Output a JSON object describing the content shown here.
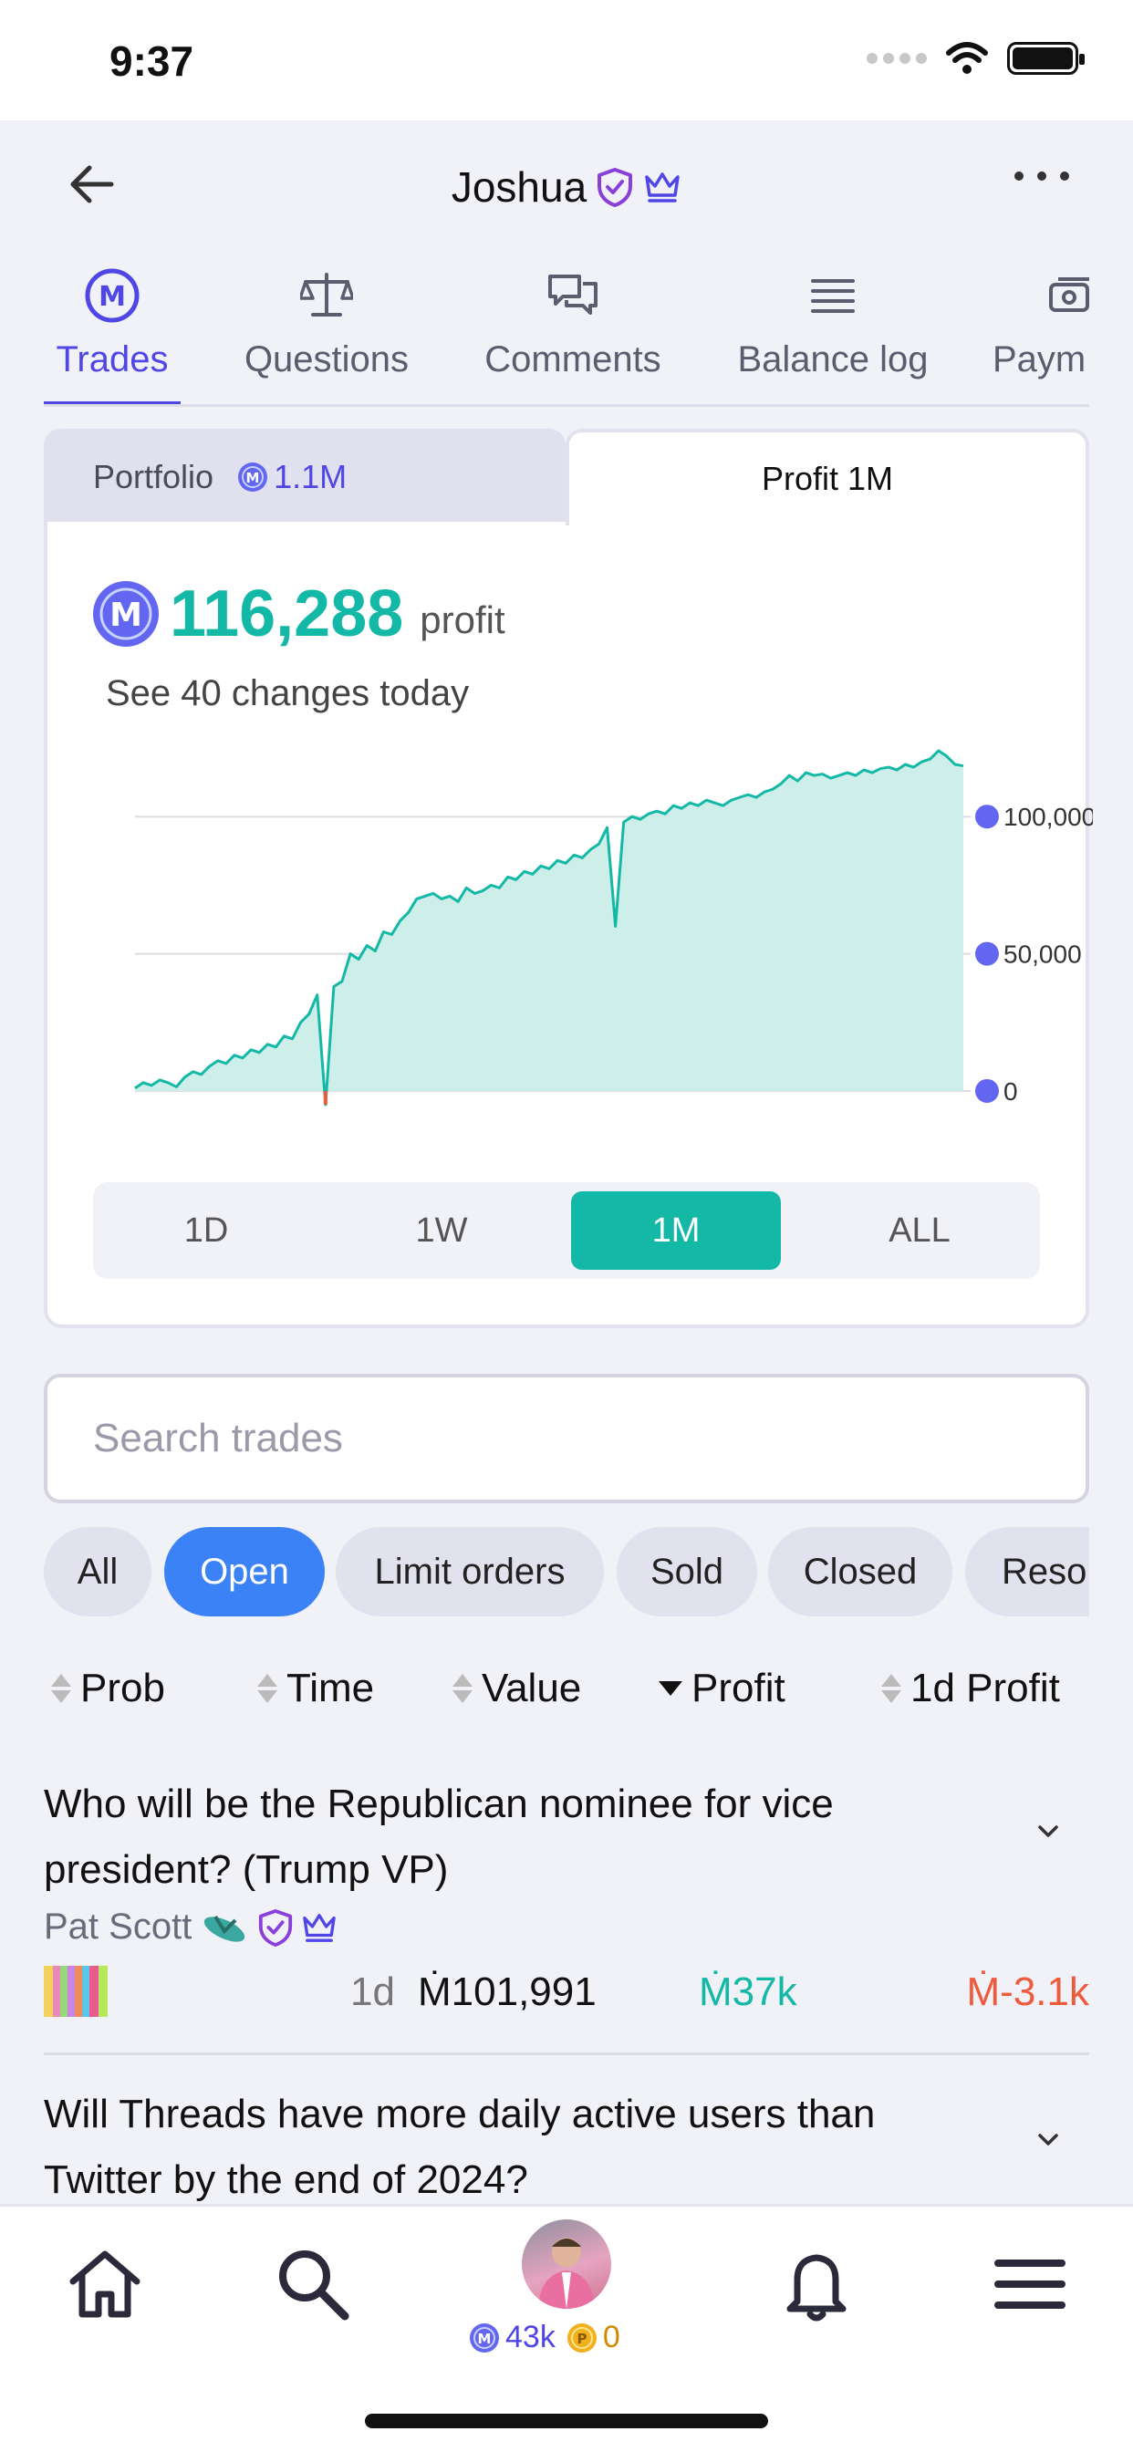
{
  "status_bar": {
    "time": "9:37"
  },
  "header": {
    "title": "Joshua"
  },
  "tabs": [
    {
      "label": "Trades",
      "icon": "mana-icon"
    },
    {
      "label": "Questions",
      "icon": "scale-icon"
    },
    {
      "label": "Comments",
      "icon": "chat-icon"
    },
    {
      "label": "Balance log",
      "icon": "list-icon"
    },
    {
      "label": "Paym",
      "icon": "payments-icon"
    }
  ],
  "portfolio": {
    "left_tab_label": "Portfolio",
    "left_tab_value": "1.1M",
    "right_tab_label": "Profit 1M",
    "profit_value": "116,288",
    "profit_word": "profit",
    "changes_text": "See 40 changes today",
    "ranges": [
      "1D",
      "1W",
      "1M",
      "ALL"
    ],
    "selected_range": "1M"
  },
  "chart_data": {
    "type": "area",
    "ylim": [
      -8000,
      125000
    ],
    "y_ticks": [
      0,
      50000,
      100000
    ],
    "y_tick_labels": [
      "0",
      "50,000",
      "100,000"
    ],
    "grid": true,
    "series": [
      {
        "color": "#14b8a6",
        "fill": "#cdeee9",
        "x": [
          0,
          1,
          2,
          3,
          4,
          5,
          6,
          7,
          8,
          9,
          10,
          11,
          12,
          13,
          14,
          15,
          16,
          17,
          18,
          19,
          20,
          21,
          22,
          23,
          24,
          25,
          26,
          27,
          28,
          29,
          30,
          31,
          32,
          33,
          34,
          35,
          36,
          37,
          38,
          39,
          40,
          41,
          42,
          43,
          44,
          45,
          46,
          47,
          48,
          49,
          50,
          51,
          52,
          53,
          54,
          55,
          56,
          57,
          58,
          59,
          60,
          61,
          62,
          63,
          64,
          65,
          66,
          67,
          68,
          69,
          70,
          71,
          72,
          73,
          74,
          75,
          76,
          77,
          78,
          79,
          80,
          81,
          82,
          83,
          84,
          85,
          86,
          87,
          88,
          89,
          90,
          91,
          92,
          93,
          94,
          95,
          96,
          97,
          98,
          99,
          100
        ],
        "y": [
          1000,
          3000,
          2000,
          4000,
          3000,
          1500,
          5000,
          7000,
          6000,
          9000,
          11000,
          10000,
          13000,
          12000,
          15000,
          14000,
          17000,
          16000,
          20000,
          19000,
          25000,
          28000,
          35000,
          -5000,
          38000,
          40000,
          50000,
          48000,
          53000,
          51000,
          58000,
          57000,
          62000,
          65000,
          70000,
          71000,
          72000,
          70000,
          71000,
          69000,
          74000,
          72000,
          73000,
          75000,
          74000,
          78000,
          77000,
          80000,
          79000,
          82000,
          81000,
          84000,
          83000,
          86000,
          85000,
          88000,
          90000,
          96000,
          60000,
          98000,
          100000,
          99000,
          101000,
          102000,
          101000,
          104000,
          103000,
          105000,
          104000,
          106000,
          105000,
          104000,
          106000,
          107000,
          108000,
          107000,
          109000,
          110000,
          112000,
          115000,
          113000,
          116000,
          115000,
          115500,
          114000,
          115000,
          116000,
          115000,
          117000,
          116000,
          117500,
          118000,
          117000,
          119000,
          118000,
          120000,
          121000,
          124000,
          122000,
          119000,
          118500
        ]
      }
    ]
  },
  "search": {
    "placeholder": "Search trades"
  },
  "filters": [
    "All",
    "Open",
    "Limit orders",
    "Sold",
    "Closed",
    "Resol"
  ],
  "selected_filter": "Open",
  "sort_columns": [
    "Prob",
    "Time",
    "Value",
    "Profit",
    "1d Profit"
  ],
  "active_sort": "Profit",
  "trades": [
    {
      "question": "Who will be the Republican nominee for vice president? (Trump VP)",
      "creator": "Pat Scott",
      "time": "1d",
      "value": "Ṁ101,991",
      "profit": "Ṁ37k",
      "day_profit": "Ṁ-3.1k"
    },
    {
      "question": "Will Threads have more daily active users than Twitter by the end of 2024?"
    }
  ],
  "bottom_nav": {
    "mana_balance": "43k",
    "prize_balance": "0"
  },
  "colors": {
    "accent": "#4f46e5",
    "profit": "#14b8a6",
    "negative": "#ef5a3c",
    "filter_active": "#3b82f6"
  }
}
